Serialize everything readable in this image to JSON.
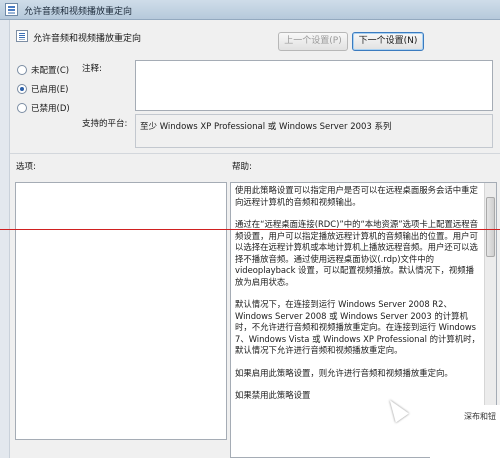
{
  "window": {
    "title": "允许音频和视频播放重定向"
  },
  "header": {
    "policy_title": "允许音频和视频播放重定向",
    "prev_button": "上一个设置(P)",
    "next_button": "下一个设置(N)"
  },
  "state_options": [
    {
      "label": "未配置(C)",
      "checked": false
    },
    {
      "label": "已启用(E)",
      "checked": true
    },
    {
      "label": "已禁用(D)",
      "checked": false
    }
  ],
  "fields": {
    "comment_label": "注释:",
    "comment_value": "",
    "platform_label": "支持的平台:",
    "platform_value": "至少 Windows XP Professional 或 Windows Server 2003 系列"
  },
  "panels": {
    "options_label": "选项:",
    "help_label": "帮助:"
  },
  "help": {
    "paragraphs": [
      "使用此策略设置可以指定用户是否可以在远程桌面服务会话中重定向远程计算机的音频和视频输出。",
      "通过在“远程桌面连接(RDC)”中的“本地资源”选项卡上配置远程音频设置，用户可以指定播放远程计算机的音频输出的位置。用户可以选择在远程计算机或本地计算机上播放远程音频。用户还可以选择不播放音频。通过使用远程桌面协议(.rdp)文件中的 videoplayback 设置，可以配置视频播放。默认情况下，视频播放为启用状态。",
      "默认情况下，在连接到运行 Windows Server 2008 R2、Windows Server 2008 或 Windows Server 2003 的计算机时，不允许进行音频和视频播放重定向。在连接到运行 Windows 7、Windows Vista 或 Windows XP Professional 的计算机时，默认情况下允许进行音频和视频播放重定向。",
      "如果启用此策略设置，则允许进行音频和视频播放重定向。",
      "如果禁用此策略设置"
    ]
  },
  "overlay": {
    "corner_text": "深布和钮"
  }
}
